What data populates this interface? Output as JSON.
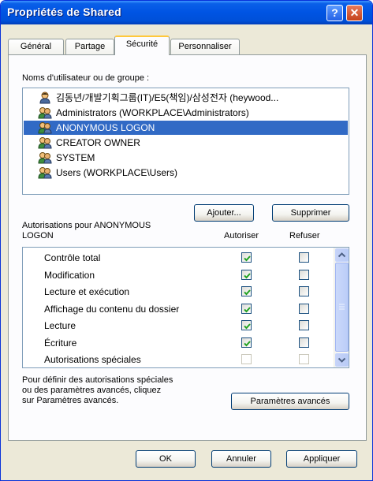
{
  "window": {
    "title": "Propriétés de Shared",
    "help_glyph": "?",
    "close_glyph": "✕"
  },
  "tabs": [
    {
      "label": "Général"
    },
    {
      "label": "Partage"
    },
    {
      "label": "Sécurité",
      "active": true
    },
    {
      "label": "Personnaliser"
    }
  ],
  "users_section": {
    "label": "Noms d'utilisateur ou de groupe :",
    "items": [
      {
        "name": "김동년/개발기획그룹(IT)/E5(책임)/삼성전자 (heywood...",
        "icon": "user-icon",
        "selected": false
      },
      {
        "name": "Administrators (WORKPLACE\\Administrators)",
        "icon": "group-icon",
        "selected": false
      },
      {
        "name": "ANONYMOUS LOGON",
        "icon": "group-icon",
        "selected": true
      },
      {
        "name": "CREATOR OWNER",
        "icon": "group-icon",
        "selected": false
      },
      {
        "name": "SYSTEM",
        "icon": "group-icon",
        "selected": false
      },
      {
        "name": "Users (WORKPLACE\\Users)",
        "icon": "group-icon",
        "selected": false
      }
    ],
    "add_button": "Ajouter...",
    "remove_button": "Supprimer"
  },
  "permissions": {
    "label": "Autorisations pour ANONYMOUS LOGON",
    "label_line1": "Autorisations pour ANONYMOUS",
    "label_line2": "LOGON",
    "col_allow": "Autoriser",
    "col_deny": "Refuser",
    "rows": [
      {
        "name": "Contrôle total",
        "allow": true,
        "deny": false
      },
      {
        "name": "Modification",
        "allow": true,
        "deny": false
      },
      {
        "name": "Lecture et exécution",
        "allow": true,
        "deny": false
      },
      {
        "name": "Affichage du contenu du dossier",
        "allow": true,
        "deny": false
      },
      {
        "name": "Lecture",
        "allow": true,
        "deny": false
      },
      {
        "name": "Écriture",
        "allow": true,
        "deny": false
      },
      {
        "name": "Autorisations spéciales",
        "allow": false,
        "deny": false,
        "disabled": true
      }
    ]
  },
  "advanced": {
    "text_line1": "Pour définir des autorisations spéciales",
    "text_line2": "ou des paramètres avancés, cliquez",
    "text_line3": "sur Paramètres avancés.",
    "button": "Paramètres avancés"
  },
  "footer": {
    "ok": "OK",
    "cancel": "Annuler",
    "apply": "Appliquer"
  }
}
